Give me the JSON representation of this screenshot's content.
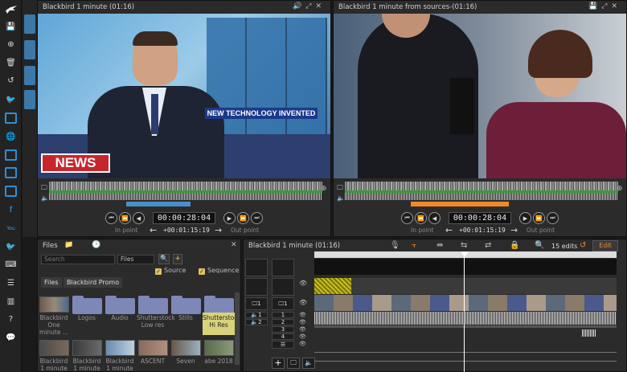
{
  "source_viewer": {
    "title": "Blackbird 1 minute (01:16)",
    "timecode": "00:00:28:04",
    "offset": "+00:01:15:19",
    "in_label": "In point",
    "out_label": "Out point",
    "overlay_banner": "NEW TECHNOLOGY INVENTED",
    "overlay_logo": "NEWS"
  },
  "sources_viewer": {
    "title": "Blackbird 1 minute from sources-(01:16)",
    "timecode": "00:00:28:04",
    "offset": "+00:01:15:19",
    "in_label": "In point",
    "out_label": "Out point"
  },
  "files": {
    "title": "Files",
    "search_placeholder": "Search",
    "filter_value": "Files",
    "source_label": "Source",
    "sequence_label": "Sequence",
    "breadcrumb": [
      "Files",
      "Blackbird Promo"
    ],
    "items_row1": [
      {
        "label": "Blackbird One minute ..."
      },
      {
        "label": "Logos"
      },
      {
        "label": "Audio"
      },
      {
        "label": "Shutterstock Low res"
      },
      {
        "label": "Stills"
      },
      {
        "label": "Shutterstock Hi Res"
      }
    ],
    "items_row2": [
      {
        "label": "Blackbird 1 minute"
      },
      {
        "label": "Blackbird 1 minute"
      },
      {
        "label": "Blackbird 1 minute"
      },
      {
        "label": "ASCENT"
      },
      {
        "label": "Seven"
      },
      {
        "label": "abe 2018"
      }
    ]
  },
  "timeline": {
    "title": "Blackbird 1 minute  (01:16)",
    "edits": "15 edits",
    "edit_button": "Edit",
    "video_tracks": [
      "1"
    ],
    "audio_tracks": [
      "1",
      "2",
      "3",
      "4"
    ],
    "track_label_1": "1",
    "track_label_2": "2"
  },
  "colors": {
    "accent_orange": "#f08a24",
    "folder": "#7d88b8",
    "brand_blue": "#3aa0e8"
  }
}
